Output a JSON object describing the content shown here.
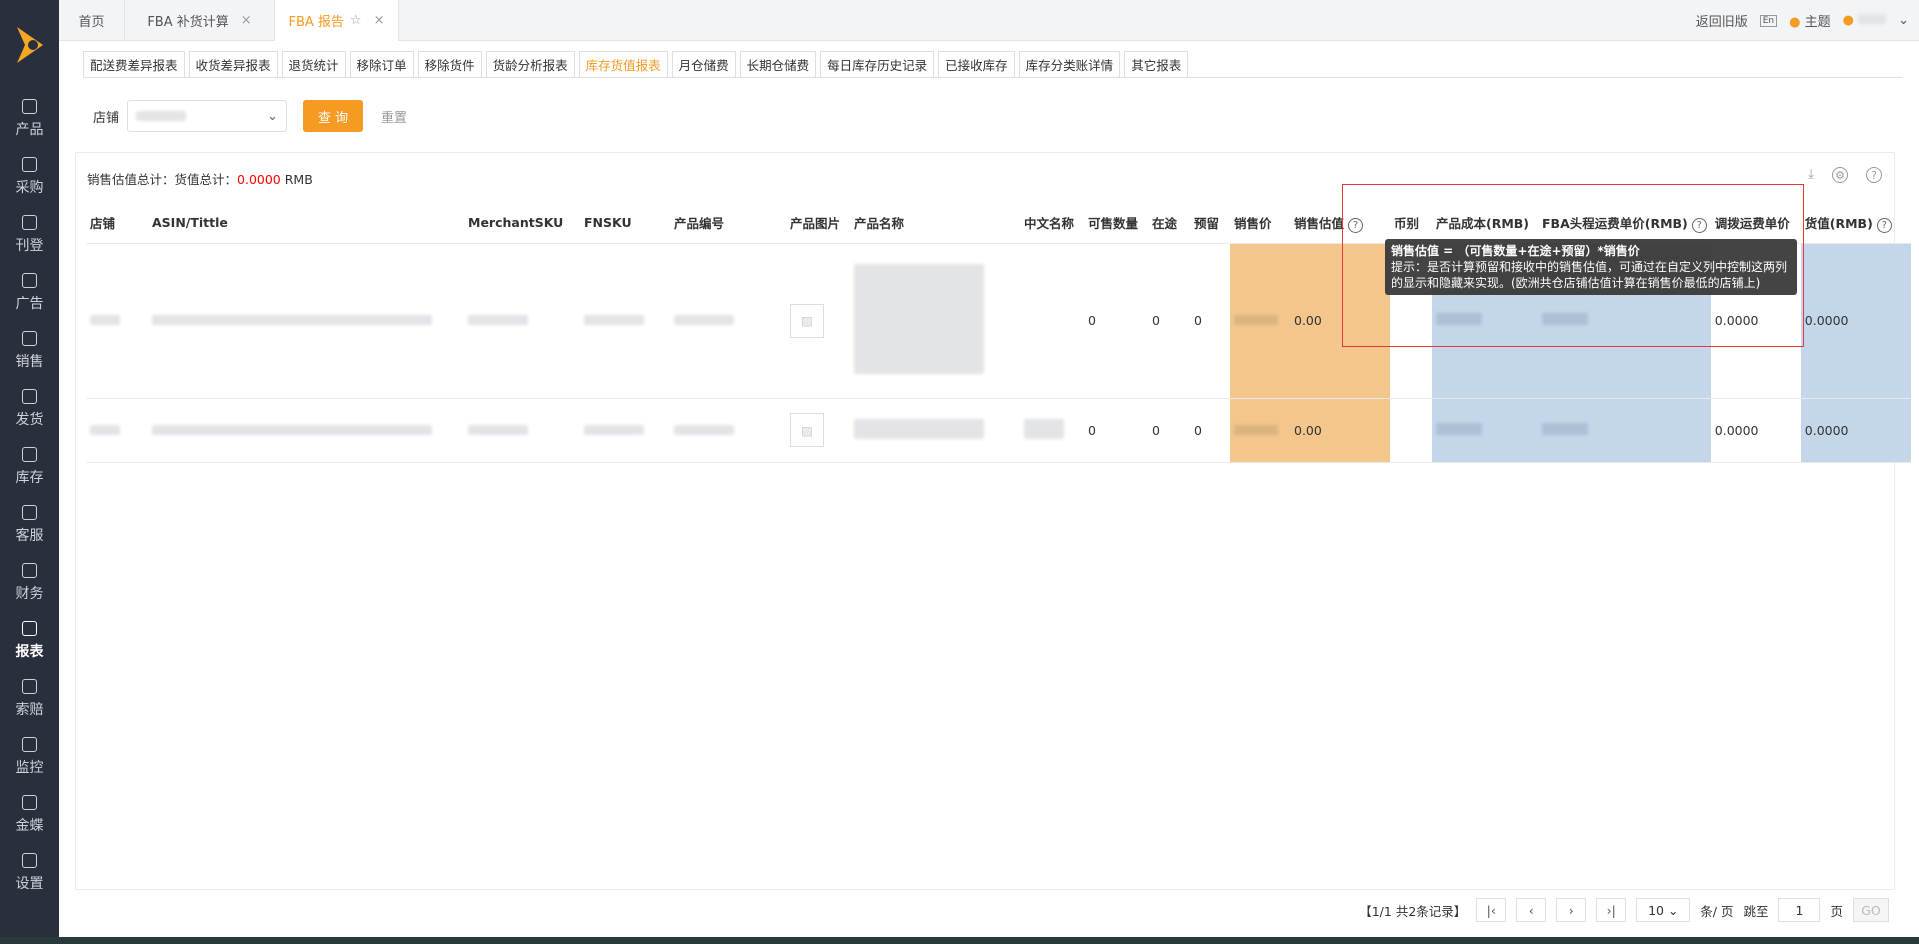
{
  "sidebar": {
    "items": [
      {
        "label": "产品"
      },
      {
        "label": "采购"
      },
      {
        "label": "刊登"
      },
      {
        "label": "广告"
      },
      {
        "label": "销售"
      },
      {
        "label": "发货"
      },
      {
        "label": "库存"
      },
      {
        "label": "客服"
      },
      {
        "label": "财务"
      },
      {
        "label": "报表"
      },
      {
        "label": "索赔"
      },
      {
        "label": "监控"
      },
      {
        "label": "金蝶"
      },
      {
        "label": "设置"
      }
    ]
  },
  "tabs": [
    {
      "label": "首页"
    },
    {
      "label": "FBA 补货计算"
    },
    {
      "label": "FBA 报告"
    }
  ],
  "topright": {
    "old": "返回旧版",
    "theme": "主题"
  },
  "subtabs": [
    "配送费差异报表",
    "收货差异报表",
    "退货统计",
    "移除订单",
    "移除货件",
    "货龄分析报表",
    "库存货值报表",
    "月仓储费",
    "长期仓储费",
    "每日库存历史记录",
    "已接收库存",
    "库存分类账详情",
    "其它报表"
  ],
  "filter": {
    "shop_label": "店铺",
    "query": "查 询",
    "reset": "重置"
  },
  "summary": {
    "prefix": "销售估值总计：货值总计：",
    "value": "0.0000",
    "unit": "RMB"
  },
  "columns": [
    "店铺",
    "ASIN/Tittle",
    "MerchantSKU",
    "FNSKU",
    "产品编号",
    "产品图片",
    "产品名称",
    "中文名称",
    "可售数量",
    "在途",
    "预留",
    "销售价",
    "销售估值",
    "币别",
    "产品成本(RMB)",
    "FBA头程运费单价(RMB)",
    "调拨运费单价",
    "货值(RMB)"
  ],
  "rows": [
    {
      "sellable": "0",
      "transit": "0",
      "reserved": "0",
      "estimate": "0.00",
      "transfer": "0.0000",
      "value": "0.0000"
    },
    {
      "sellable": "0",
      "transit": "0",
      "reserved": "0",
      "estimate": "0.00",
      "transfer": "0.0000",
      "value": "0.0000"
    }
  ],
  "tooltip": {
    "line1": "销售估值 = （可售数量+在途+预留）*销售价",
    "line2": "提示：是否计算预留和接收中的销售估值，可通过在自定义列中控制这两列的显示和隐藏来实现。(欧洲共仓店铺估值计算在销售价最低的店铺上)"
  },
  "pager": {
    "info": "【1/1  共2条记录】",
    "size": "10",
    "per": "条/ 页",
    "jump": "跳至",
    "page": "1",
    "page_unit": "页",
    "go": "GO"
  }
}
